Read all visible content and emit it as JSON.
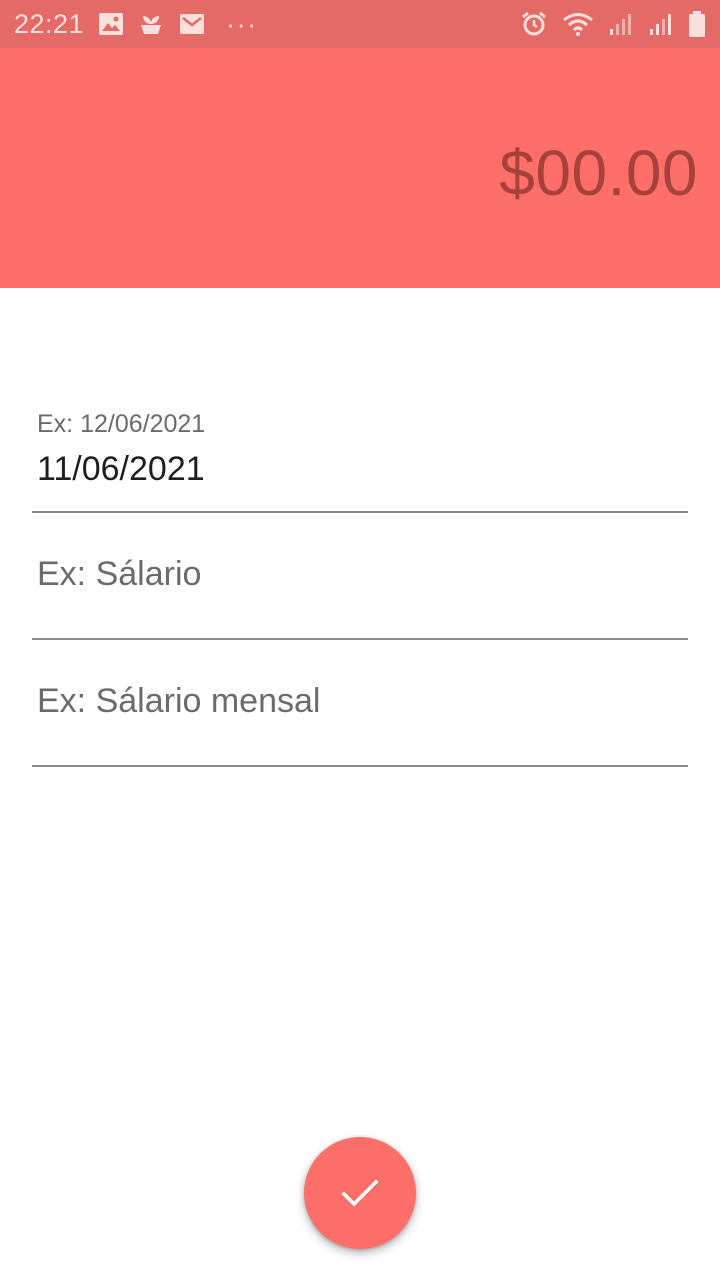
{
  "status_bar": {
    "time": "22:21",
    "more_indicator": "···",
    "left_icons": [
      "image-icon",
      "plant-icon",
      "mail-icon"
    ],
    "right_icons": [
      "alarm-icon",
      "wifi-icon",
      "signal-icon",
      "signal-icon",
      "battery-icon"
    ]
  },
  "header": {
    "amount": "$00.00"
  },
  "form": {
    "date_label": "Ex: 12/06/2021",
    "date_value": "11/06/2021",
    "category_placeholder": "Ex: Sálario",
    "description_placeholder": "Ex: Sálario mensal"
  },
  "fab": {
    "icon": "check-icon"
  },
  "colors": {
    "status_bar": "#e36a65",
    "header": "#ff6f69",
    "amount_text": "#a6413c",
    "fab": "#ff6f69"
  }
}
